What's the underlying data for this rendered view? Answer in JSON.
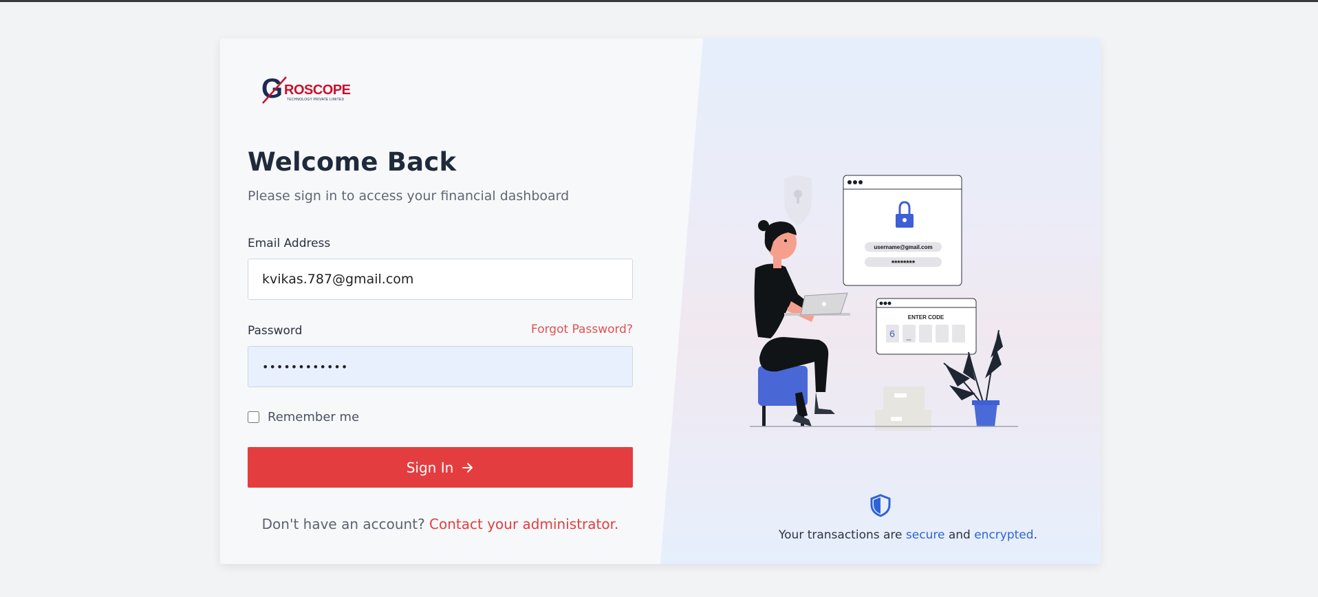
{
  "brand": {
    "logo_letter": "G",
    "logo_word": "ROSCOPE",
    "logo_subtitle": "TECHNOLOGY PRIVATE LIMITED"
  },
  "login": {
    "title": "Welcome Back",
    "subtitle": "Please sign in to access your financial dashboard",
    "email_label": "Email Address",
    "email_value": "kvikas.787@gmail.com",
    "password_label": "Password",
    "password_value": "••••••••••••",
    "forgot_password": "Forgot Password?",
    "remember_me": "Remember me",
    "remember_checked": false,
    "sign_in": "Sign In",
    "no_account": "Don't have an account?",
    "contact_admin": "Contact your administrator."
  },
  "illustration": {
    "username_text": "username@gmail.com",
    "password_text": "********",
    "enter_code": "ENTER CODE",
    "code_digit": "6",
    "code_cursor": "_"
  },
  "security_note": {
    "prefix": "Your transactions are",
    "secure": "secure",
    "and": "and",
    "encrypted": "encrypted",
    "suffix": "."
  },
  "colors": {
    "accent_red": "#e43d40",
    "link_blue": "#2d63d6",
    "title_dark": "#1f2a3c",
    "brand_navy": "#1c2a54"
  },
  "icons": {
    "arrow": "arrow-right-icon",
    "shield": "shield-icon",
    "lock": "lock-icon"
  }
}
